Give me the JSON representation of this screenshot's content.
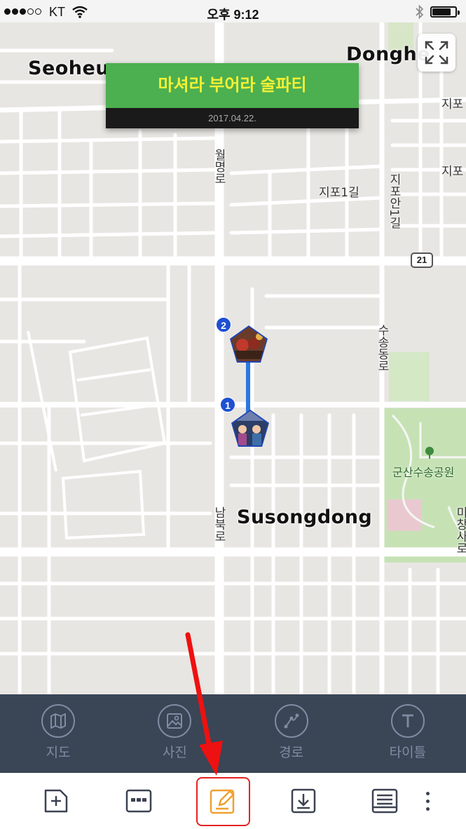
{
  "status_bar": {
    "carrier": "KT",
    "time": "오후 9:12",
    "signal_bars": 3,
    "signal_total": 5
  },
  "map": {
    "area_labels": [
      "Seoheun",
      "Donghe",
      "Susongdong"
    ],
    "street_labels": {
      "left_road_top": "월명로",
      "left_road_bottom": "남북로",
      "jipo1gil": "지포1길",
      "jipoan1gil": "지포안1길",
      "susongdongro": "수송동로",
      "jipo_right1": "지포",
      "jipo_right2": "지포",
      "michang": "미창사로"
    },
    "park_label": "군산수송공원",
    "route_badge": "21",
    "route_color": "#2a78e0",
    "park_color": "#c6e2b5",
    "icons": [
      "fullscreen-icon",
      "tree-icon"
    ]
  },
  "title_card": {
    "title": "마셔라 부어라 술파티",
    "date": "2017.04.22.",
    "title_bg": "#4caf50",
    "title_color": "#f3f034"
  },
  "markers": [
    {
      "number": "2"
    },
    {
      "number": "1"
    }
  ],
  "tool_bar": {
    "items": [
      {
        "label": "지도",
        "icon": "map-icon"
      },
      {
        "label": "사진",
        "icon": "photo-icon"
      },
      {
        "label": "경로",
        "icon": "route-icon"
      },
      {
        "label": "타이틀",
        "icon": "title-icon"
      }
    ]
  },
  "action_bar": {
    "icons": [
      "add-page-icon",
      "layout-icon",
      "edit-icon",
      "download-icon",
      "list-icon",
      "more-icon"
    ],
    "highlight_color": "#e52222",
    "edit_accent": "#f0a030"
  }
}
